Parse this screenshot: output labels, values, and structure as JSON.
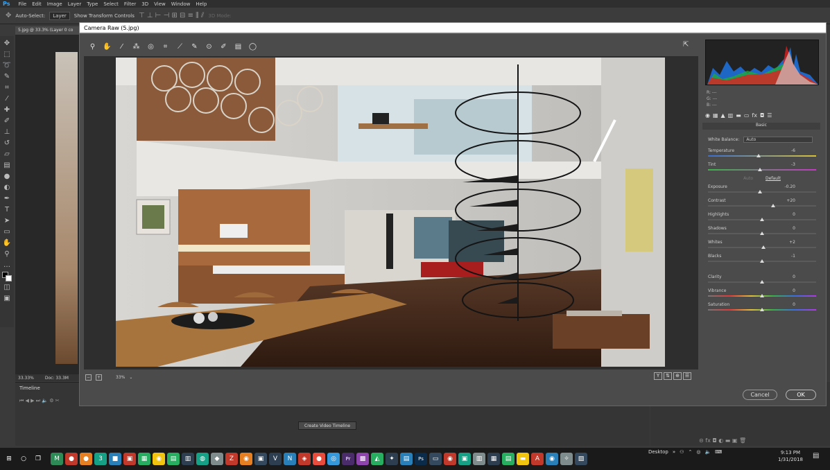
{
  "photoshop": {
    "logo": "Ps",
    "menu": [
      "File",
      "Edit",
      "Image",
      "Layer",
      "Type",
      "Select",
      "Filter",
      "3D",
      "View",
      "Window",
      "Help"
    ],
    "options": {
      "auto_select_label": "Auto-Select:",
      "auto_select_value": "Layer",
      "transform_controls_label": "Show Transform Controls",
      "mode_label": "3D Mode:"
    },
    "doc_tab": "5.jpg @ 33.3% (Layer 0 co",
    "status_zoom": "33.33%",
    "status_doc": "Doc: 33.3M",
    "timeline_title": "Timeline",
    "create_video_timeline": "Create Video Timeline",
    "tools": [
      "move-icon",
      "marquee-icon",
      "lasso-icon",
      "quick-select-icon",
      "crop-icon",
      "eyedropper-icon",
      "healing-icon",
      "brush-icon",
      "stamp-icon",
      "history-brush-icon",
      "eraser-icon",
      "gradient-icon",
      "blur-icon",
      "dodge-icon",
      "pen-icon",
      "type-icon",
      "path-select-icon",
      "shape-icon",
      "hand-icon",
      "zoom-icon",
      "more-icon"
    ]
  },
  "camera_raw": {
    "title": "Camera Raw (5.jpg)",
    "zoom": "33%",
    "tools": [
      "zoom-icon",
      "hand-icon",
      "white-balance-icon",
      "color-sampler-icon",
      "target-adjust-icon",
      "crop-icon",
      "straighten-icon",
      "spot-removal-icon",
      "red-eye-icon",
      "adjustment-brush-icon",
      "graduated-filter-icon",
      "radial-filter-icon"
    ],
    "rgb": {
      "r": "R:  ---",
      "g": "G:  ---",
      "b": "B:  ---"
    },
    "section": "Basic",
    "white_balance_label": "White Balance:",
    "white_balance_value": "Auto",
    "auto_label": "Auto",
    "default_label": "Default",
    "sliders": [
      {
        "label": "Temperature",
        "value": "-6",
        "level": 0.47,
        "group": 1
      },
      {
        "label": "Tint",
        "value": "-3",
        "level": 0.48,
        "group": 1
      },
      {
        "label": "Exposure",
        "value": "-0.20",
        "level": 0.48,
        "group": 2
      },
      {
        "label": "Contrast",
        "value": "+20",
        "level": 0.6,
        "group": 2
      },
      {
        "label": "Highlights",
        "value": "0",
        "level": 0.5,
        "group": 2
      },
      {
        "label": "Shadows",
        "value": "0",
        "level": 0.5,
        "group": 2
      },
      {
        "label": "Whites",
        "value": "+2",
        "level": 0.51,
        "group": 2
      },
      {
        "label": "Blacks",
        "value": "-1",
        "level": 0.5,
        "group": 2
      },
      {
        "label": "Clarity",
        "value": "0",
        "level": 0.5,
        "group": 3
      },
      {
        "label": "Vibrance",
        "value": "0",
        "level": 0.5,
        "group": 3
      },
      {
        "label": "Saturation",
        "value": "0",
        "level": 0.5,
        "group": 3
      }
    ],
    "cancel": "Cancel",
    "ok": "OK"
  },
  "taskbar": {
    "desktop_label": "Desktop",
    "time": "9:13 PM",
    "date": "1/31/2018",
    "icons": [
      {
        "name": "start-icon",
        "color": "#1a1a1a",
        "glyph": "⊞"
      },
      {
        "name": "search-icon",
        "color": "#1a1a1a",
        "glyph": "○"
      },
      {
        "name": "task-view-icon",
        "color": "#1a1a1a",
        "glyph": "❐"
      },
      {
        "name": "app-icon-1",
        "color": "#2e8b57",
        "glyph": "M"
      },
      {
        "name": "app-icon-2",
        "color": "#c0392b",
        "glyph": "●"
      },
      {
        "name": "app-icon-3",
        "color": "#e67e22",
        "glyph": "●"
      },
      {
        "name": "app-icon-4",
        "color": "#16a085",
        "glyph": "3"
      },
      {
        "name": "app-icon-5",
        "color": "#2980b9",
        "glyph": "■"
      },
      {
        "name": "app-icon-6",
        "color": "#c0392b",
        "glyph": "▣"
      },
      {
        "name": "app-icon-7",
        "color": "#27ae60",
        "glyph": "▦"
      },
      {
        "name": "chrome-icon",
        "color": "#f1c40f",
        "glyph": "◉"
      },
      {
        "name": "app-icon-8",
        "color": "#27ae60",
        "glyph": "▤"
      },
      {
        "name": "app-icon-9",
        "color": "#2c3e50",
        "glyph": "▥"
      },
      {
        "name": "app-icon-10",
        "color": "#16a085",
        "glyph": "◍"
      },
      {
        "name": "app-icon-11",
        "color": "#7f8c8d",
        "glyph": "◆"
      },
      {
        "name": "app-icon-12",
        "color": "#c0392b",
        "glyph": "Z"
      },
      {
        "name": "firefox-icon",
        "color": "#e67e22",
        "glyph": "◉"
      },
      {
        "name": "app-icon-13",
        "color": "#34495e",
        "glyph": "▣"
      },
      {
        "name": "app-icon-14",
        "color": "#2c3e50",
        "glyph": "V"
      },
      {
        "name": "app-icon-15",
        "color": "#2980b9",
        "glyph": "N"
      },
      {
        "name": "app-icon-16",
        "color": "#c0392b",
        "glyph": "◈"
      },
      {
        "name": "app-icon-17",
        "color": "#e74c3c",
        "glyph": "●"
      },
      {
        "name": "app-icon-18",
        "color": "#3498db",
        "glyph": "◎"
      },
      {
        "name": "premiere-icon",
        "color": "#4b2c6b",
        "glyph": "Pr"
      },
      {
        "name": "app-icon-19",
        "color": "#8e44ad",
        "glyph": "▩"
      },
      {
        "name": "app-icon-20",
        "color": "#27ae60",
        "glyph": "◭"
      },
      {
        "name": "app-icon-21",
        "color": "#2c3e50",
        "glyph": "✦"
      },
      {
        "name": "app-icon-22",
        "color": "#2980b9",
        "glyph": "▤"
      },
      {
        "name": "photoshop-icon",
        "color": "#0b2b4a",
        "glyph": "Ps"
      },
      {
        "name": "app-icon-23",
        "color": "#34495e",
        "glyph": "▭"
      },
      {
        "name": "app-icon-24",
        "color": "#c0392b",
        "glyph": "◉"
      },
      {
        "name": "app-icon-25",
        "color": "#16a085",
        "glyph": "▣"
      },
      {
        "name": "app-icon-26",
        "color": "#7f8c8d",
        "glyph": "▥"
      },
      {
        "name": "app-icon-27",
        "color": "#2c3e50",
        "glyph": "▦"
      },
      {
        "name": "app-icon-28",
        "color": "#27ae60",
        "glyph": "▤"
      },
      {
        "name": "folder-icon",
        "color": "#f1c40f",
        "glyph": "▬"
      },
      {
        "name": "app-icon-29",
        "color": "#c0392b",
        "glyph": "A"
      },
      {
        "name": "app-icon-30",
        "color": "#2980b9",
        "glyph": "◉"
      },
      {
        "name": "app-icon-31",
        "color": "#7f8c8d",
        "glyph": "✧"
      },
      {
        "name": "app-icon-32",
        "color": "#34495e",
        "glyph": "▨"
      }
    ]
  }
}
